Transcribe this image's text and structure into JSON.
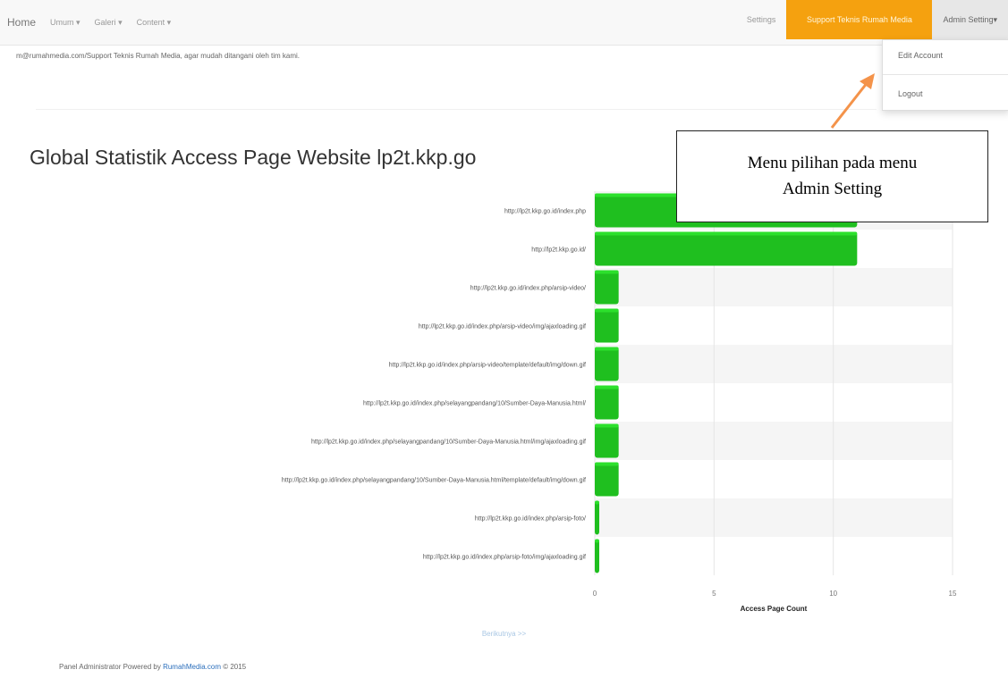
{
  "navbar": {
    "brand": "Home",
    "left_items": [
      "Umum",
      "Galeri",
      "Content"
    ],
    "settings": "Settings",
    "support": "Support Teknis Rumah Media",
    "admin": "Admin Setting"
  },
  "dropdown": {
    "items": [
      "Edit Account",
      "Logout"
    ]
  },
  "notice": "m@rumahmedia.com/Support Teknis Rumah Media, agar mudah ditangani oleh tim kami.",
  "stats_title": "Global Statistik Access Page Website lp2t.kkp.go",
  "callout": {
    "line1": "Menu pilihan pada menu",
    "line2": "Admin Setting"
  },
  "chart_data": {
    "type": "bar",
    "orientation": "horizontal",
    "categories": [
      "http://lp2t.kkp.go.id/index.php",
      "http://lp2t.kkp.go.id/",
      "http://lp2t.kkp.go.id/index.php/arsip-video/",
      "http://lp2t.kkp.go.id/index.php/arsip-video/img/ajaxloading.gif",
      "http://lp2t.kkp.go.id/index.php/arsip-video/template/default/img/down.gif",
      "http://lp2t.kkp.go.id/index.php/selayangpandang/10/Sumber-Daya-Manusia.html/",
      "http://lp2t.kkp.go.id/index.php/selayangpandang/10/Sumber-Daya-Manusia.html/img/ajaxloading.gif",
      "http://lp2t.kkp.go.id/index.php/selayangpandang/10/Sumber-Daya-Manusia.html/template/default/img/down.gif",
      "http://lp2t.kkp.go.id/index.php/arsip-foto/",
      "http://lp2t.kkp.go.id/index.php/arsip-foto/img/ajaxloading.gif"
    ],
    "values": [
      11,
      11,
      1,
      1,
      1,
      1,
      1,
      1,
      0,
      0
    ],
    "xlabel": "Access Page Count",
    "ticks": [
      0,
      5,
      10,
      15
    ],
    "xlim": [
      0,
      15
    ],
    "bar_color": "#1fbf1f"
  },
  "pagination": {
    "next": "Berikutnya >>"
  },
  "footer": {
    "prefix": "Panel Administrator Powered by ",
    "link": "RumahMedia.com",
    "suffix": " © 2015"
  }
}
